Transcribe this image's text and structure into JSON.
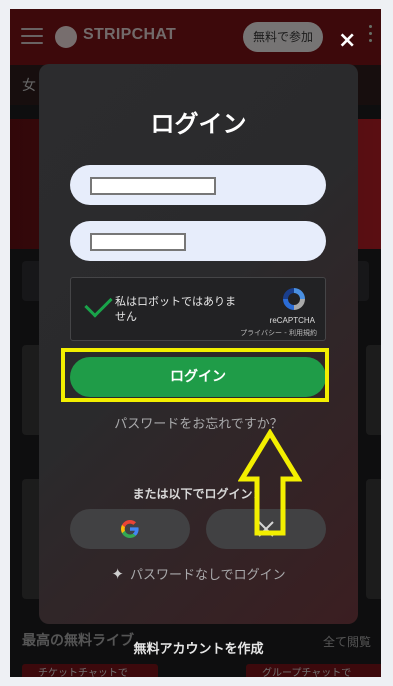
{
  "header": {
    "brand": "STRIPCHAT",
    "join_label": "無料で参加",
    "close_glyph": "×"
  },
  "background": {
    "tab_text": "女",
    "section_heading": "最高の無料ライブ",
    "section_link": "全て閲覧",
    "chip_1": "チケットチャットで",
    "chip_2": "グループチャットで"
  },
  "modal": {
    "title": "ログイン",
    "captcha": {
      "text": "私はロボットではありません",
      "brand": "reCAPTCHA",
      "links": "プライバシー - 利用規約"
    },
    "login_button": "ログイン",
    "forgot_password": "パスワードをお忘れですか？",
    "or_login_with": "または以下でログイン：",
    "passwordless": "パスワードなしでログイン",
    "create_account": "無料アカウントを作成"
  },
  "colors": {
    "accent_green": "#1f9c48",
    "highlight_yellow": "#f3ef00",
    "header_red": "#6f1115"
  },
  "icons": [
    "hamburger-icon",
    "stripchat-logo-icon",
    "kebab-menu-icon",
    "close-icon",
    "check-icon",
    "recaptcha-icon",
    "google-icon",
    "x-twitter-icon",
    "sparkle-icon",
    "up-arrow-annotation"
  ]
}
